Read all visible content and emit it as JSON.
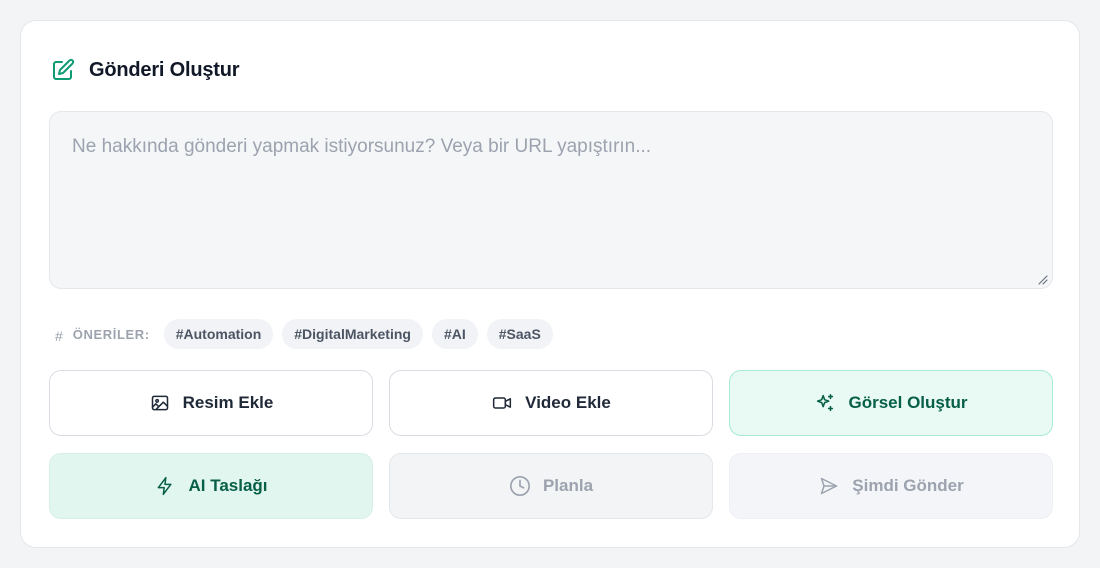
{
  "composer": {
    "title": "Gönderi Oluştur",
    "placeholder": "Ne hakkında gönderi yapmak istiyorsunuz? Veya bir URL yapıştırın...",
    "value": ""
  },
  "suggestions": {
    "hash_symbol": "#",
    "label": "ÖNERİLER:",
    "tags": [
      "#Automation",
      "#DigitalMarketing",
      "#AI",
      "#SaaS"
    ]
  },
  "actions": {
    "add_image": "Resim Ekle",
    "add_video": "Video Ekle",
    "generate_visual": "Görsel Oluştur",
    "ai_draft": "AI Taslağı",
    "schedule": "Planla",
    "send_now": "Şimdi Gönder"
  },
  "colors": {
    "accent": "#10b981",
    "accent_dark": "#065f46",
    "muted": "#9ca3af"
  },
  "icons": {
    "title": "edit-icon",
    "add_image": "image-icon",
    "add_video": "video-icon",
    "generate_visual": "sparkles-icon",
    "ai_draft": "lightning-icon",
    "schedule": "clock-icon",
    "send_now": "send-icon"
  }
}
